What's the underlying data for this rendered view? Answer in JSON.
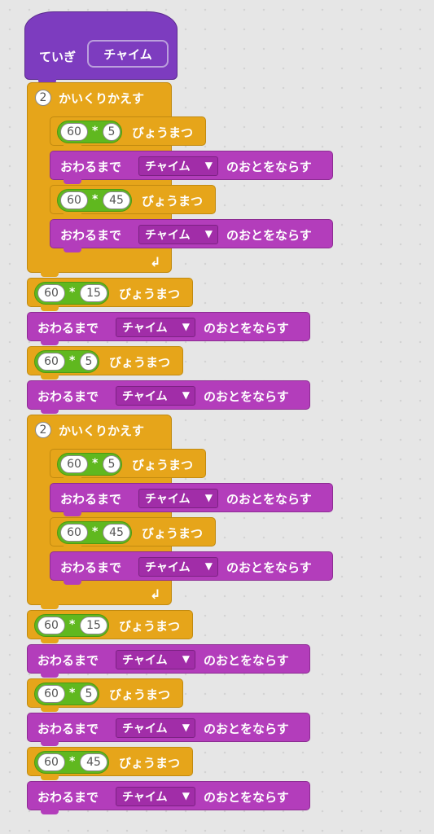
{
  "define_block": {
    "label": "ていぎ",
    "name": "チャイム"
  },
  "repeat_label": "かいくりかえす",
  "wait_label": "びょうまつ",
  "sound_label": "おわるまで",
  "sound_suffix": "のおとをならす",
  "sound_name": "チャイム",
  "dropdown_caret": "▼",
  "repeat_arrow": "↲",
  "multiply_op": "*",
  "sequence": [
    {
      "type": "repeat",
      "count": "2",
      "body": [
        {
          "type": "wait",
          "a": "60",
          "b": "5"
        },
        {
          "type": "sound"
        },
        {
          "type": "wait",
          "a": "60",
          "b": "45"
        },
        {
          "type": "sound"
        }
      ]
    },
    {
      "type": "wait",
      "a": "60",
      "b": "15"
    },
    {
      "type": "sound"
    },
    {
      "type": "wait",
      "a": "60",
      "b": "5"
    },
    {
      "type": "sound"
    },
    {
      "type": "repeat",
      "count": "2",
      "body": [
        {
          "type": "wait",
          "a": "60",
          "b": "5"
        },
        {
          "type": "sound"
        },
        {
          "type": "wait",
          "a": "60",
          "b": "45"
        },
        {
          "type": "sound"
        }
      ]
    },
    {
      "type": "wait",
      "a": "60",
      "b": "15"
    },
    {
      "type": "sound"
    },
    {
      "type": "wait",
      "a": "60",
      "b": "5"
    },
    {
      "type": "sound"
    },
    {
      "type": "wait",
      "a": "60",
      "b": "45"
    },
    {
      "type": "sound"
    }
  ]
}
